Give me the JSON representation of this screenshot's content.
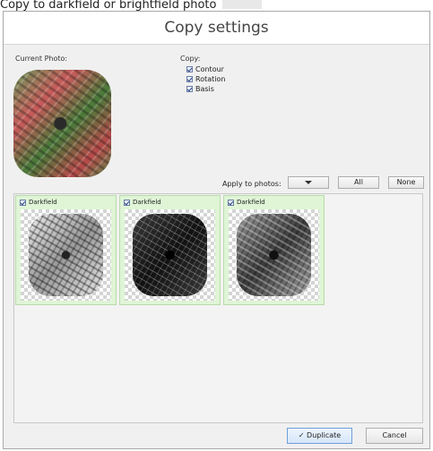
{
  "caption": "Copy to darkfield or brightfield photo",
  "dialog": {
    "title": "Copy settings",
    "current_photo_label": "Current Photo:",
    "copy_label": "Copy:",
    "copy_options": [
      {
        "label": "Contour",
        "checked": true
      },
      {
        "label": "Rotation",
        "checked": true
      },
      {
        "label": "Basis",
        "checked": true
      }
    ],
    "apply_label": "Apply to photos:",
    "all_button": "All",
    "none_button": "None",
    "photos": [
      {
        "label": "Darkfield",
        "checked": true
      },
      {
        "label": "Darkfield",
        "checked": true
      },
      {
        "label": "Darkfield",
        "checked": true
      }
    ],
    "duplicate_button": "✓ Duplicate",
    "cancel_button": "Cancel"
  }
}
